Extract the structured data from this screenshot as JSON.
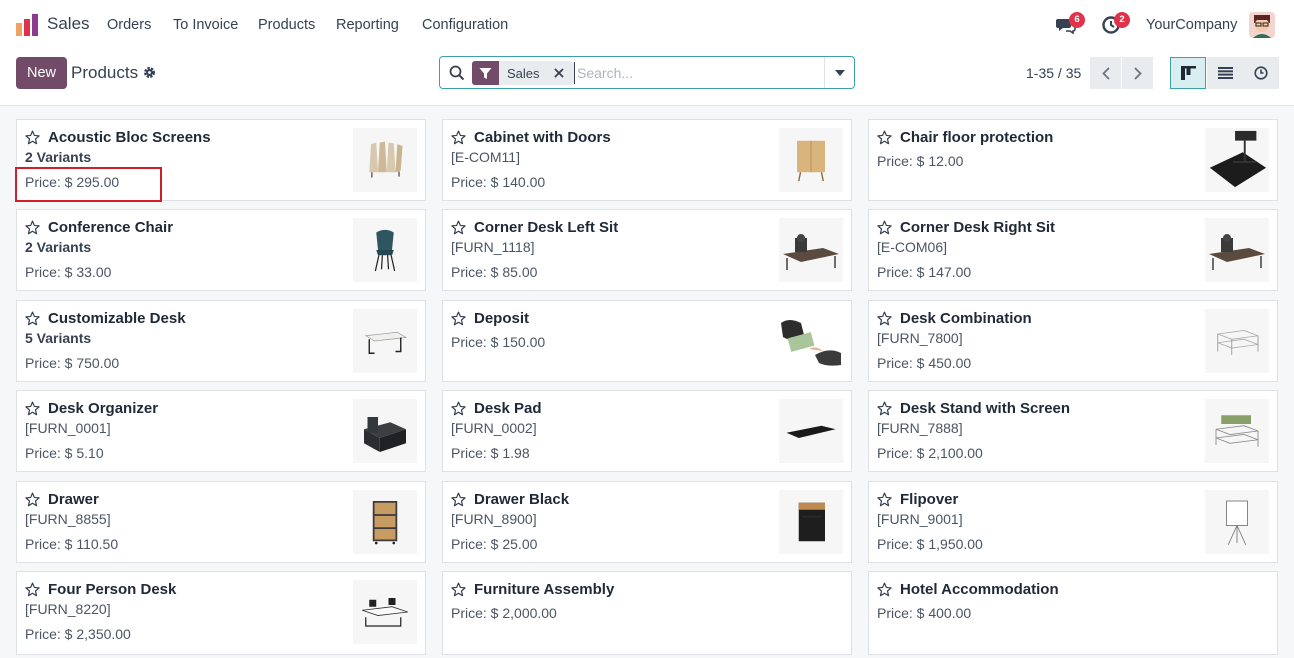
{
  "app": {
    "name": "Sales"
  },
  "menu": [
    "Orders",
    "To Invoice",
    "Products",
    "Reporting",
    "Configuration"
  ],
  "systray": {
    "messages_count": "6",
    "activities_count": "2",
    "company": "YourCompany"
  },
  "control": {
    "new_label": "New",
    "breadcrumb": "Products",
    "facet_label": "Sales",
    "search_placeholder": "Search...",
    "pager": "1-35 / 35"
  },
  "colors": {
    "brand": "#714b67",
    "accent": "#3da0a8",
    "badge": "#e0324b",
    "highlight": "#d01f2a"
  },
  "products": [
    {
      "name": "Acoustic Bloc Screens",
      "sub": "2 Variants",
      "variants": true,
      "price": "Price: $ 295.00",
      "thumb": "screen"
    },
    {
      "name": "Cabinet with Doors",
      "sub": "[E-COM11]",
      "variants": false,
      "price": "Price: $ 140.00",
      "thumb": "cabinet"
    },
    {
      "name": "Chair floor protection",
      "sub": "",
      "variants": false,
      "price": "Price: $ 12.00",
      "thumb": "mat"
    },
    {
      "name": "Conference Chair",
      "sub": "2 Variants",
      "variants": true,
      "price": "Price: $ 33.00",
      "thumb": "chair"
    },
    {
      "name": "Corner Desk Left Sit",
      "sub": "[FURN_1118]",
      "variants": false,
      "price": "Price: $ 85.00",
      "thumb": "corner-desk"
    },
    {
      "name": "Corner Desk Right Sit",
      "sub": "[E-COM06]",
      "variants": false,
      "price": "Price: $ 147.00",
      "thumb": "corner-desk"
    },
    {
      "name": "Customizable Desk",
      "sub": "5 Variants",
      "variants": true,
      "price": "Price: $ 750.00",
      "thumb": "desk"
    },
    {
      "name": "Deposit",
      "sub": "",
      "variants": false,
      "price": "Price: $ 150.00",
      "thumb": "money"
    },
    {
      "name": "Desk Combination",
      "sub": "[FURN_7800]",
      "variants": false,
      "price": "Price: $ 450.00",
      "thumb": "combo"
    },
    {
      "name": "Desk Organizer",
      "sub": "[FURN_0001]",
      "variants": false,
      "price": "Price: $ 5.10",
      "thumb": "organizer"
    },
    {
      "name": "Desk Pad",
      "sub": "[FURN_0002]",
      "variants": false,
      "price": "Price: $ 1.98",
      "thumb": "pad"
    },
    {
      "name": "Desk Stand with Screen",
      "sub": "[FURN_7888]",
      "variants": false,
      "price": "Price: $ 2,100.00",
      "thumb": "stand"
    },
    {
      "name": "Drawer",
      "sub": "[FURN_8855]",
      "variants": false,
      "price": "Price: $ 110.50",
      "thumb": "drawer"
    },
    {
      "name": "Drawer Black",
      "sub": "[FURN_8900]",
      "variants": false,
      "price": "Price: $ 25.00",
      "thumb": "drawer-black"
    },
    {
      "name": "Flipover",
      "sub": "[FURN_9001]",
      "variants": false,
      "price": "Price: $ 1,950.00",
      "thumb": "flipover"
    },
    {
      "name": "Four Person Desk",
      "sub": "[FURN_8220]",
      "variants": false,
      "price": "Price: $ 2,350.00",
      "thumb": "four-desk"
    },
    {
      "name": "Furniture Assembly",
      "sub": "",
      "variants": false,
      "price": "Price: $ 2,000.00",
      "thumb": ""
    },
    {
      "name": "Hotel Accommodation",
      "sub": "",
      "variants": false,
      "price": "Price: $ 400.00",
      "thumb": ""
    }
  ]
}
